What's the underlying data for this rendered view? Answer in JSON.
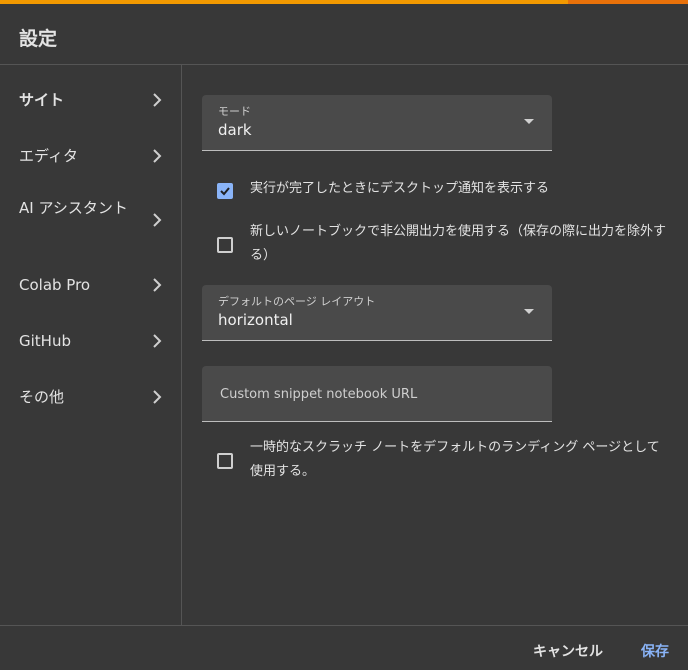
{
  "dialog": {
    "title": "設定"
  },
  "sidebar": {
    "items": [
      {
        "label": "サイト",
        "active": true
      },
      {
        "label": "エディタ"
      },
      {
        "label": "AI アシスタント"
      },
      {
        "label": "Colab Pro"
      },
      {
        "label": "GitHub"
      },
      {
        "label": "その他"
      }
    ]
  },
  "settings": {
    "mode": {
      "label": "モード",
      "value": "dark"
    },
    "desktop_notify": {
      "label": "実行が完了したときにデスクトップ通知を表示する",
      "checked": true
    },
    "private_output": {
      "label": "新しいノートブックで非公開出力を使用する（保存の際に出力を除外する）",
      "checked": false
    },
    "page_layout": {
      "label": "デフォルトのページ レイアウト",
      "value": "horizontal"
    },
    "snippet_url": {
      "placeholder": "Custom snippet notebook URL",
      "value": ""
    },
    "scratch_landing": {
      "label": "一時的なスクラッチ ノートをデフォルトのランディング ページとして使用する。",
      "checked": false
    }
  },
  "footer": {
    "cancel_label": "キャンセル",
    "save_label": "保存"
  },
  "colors": {
    "accent": "#8ab4f8",
    "top_bar": "#f29900",
    "background": "#383838"
  }
}
